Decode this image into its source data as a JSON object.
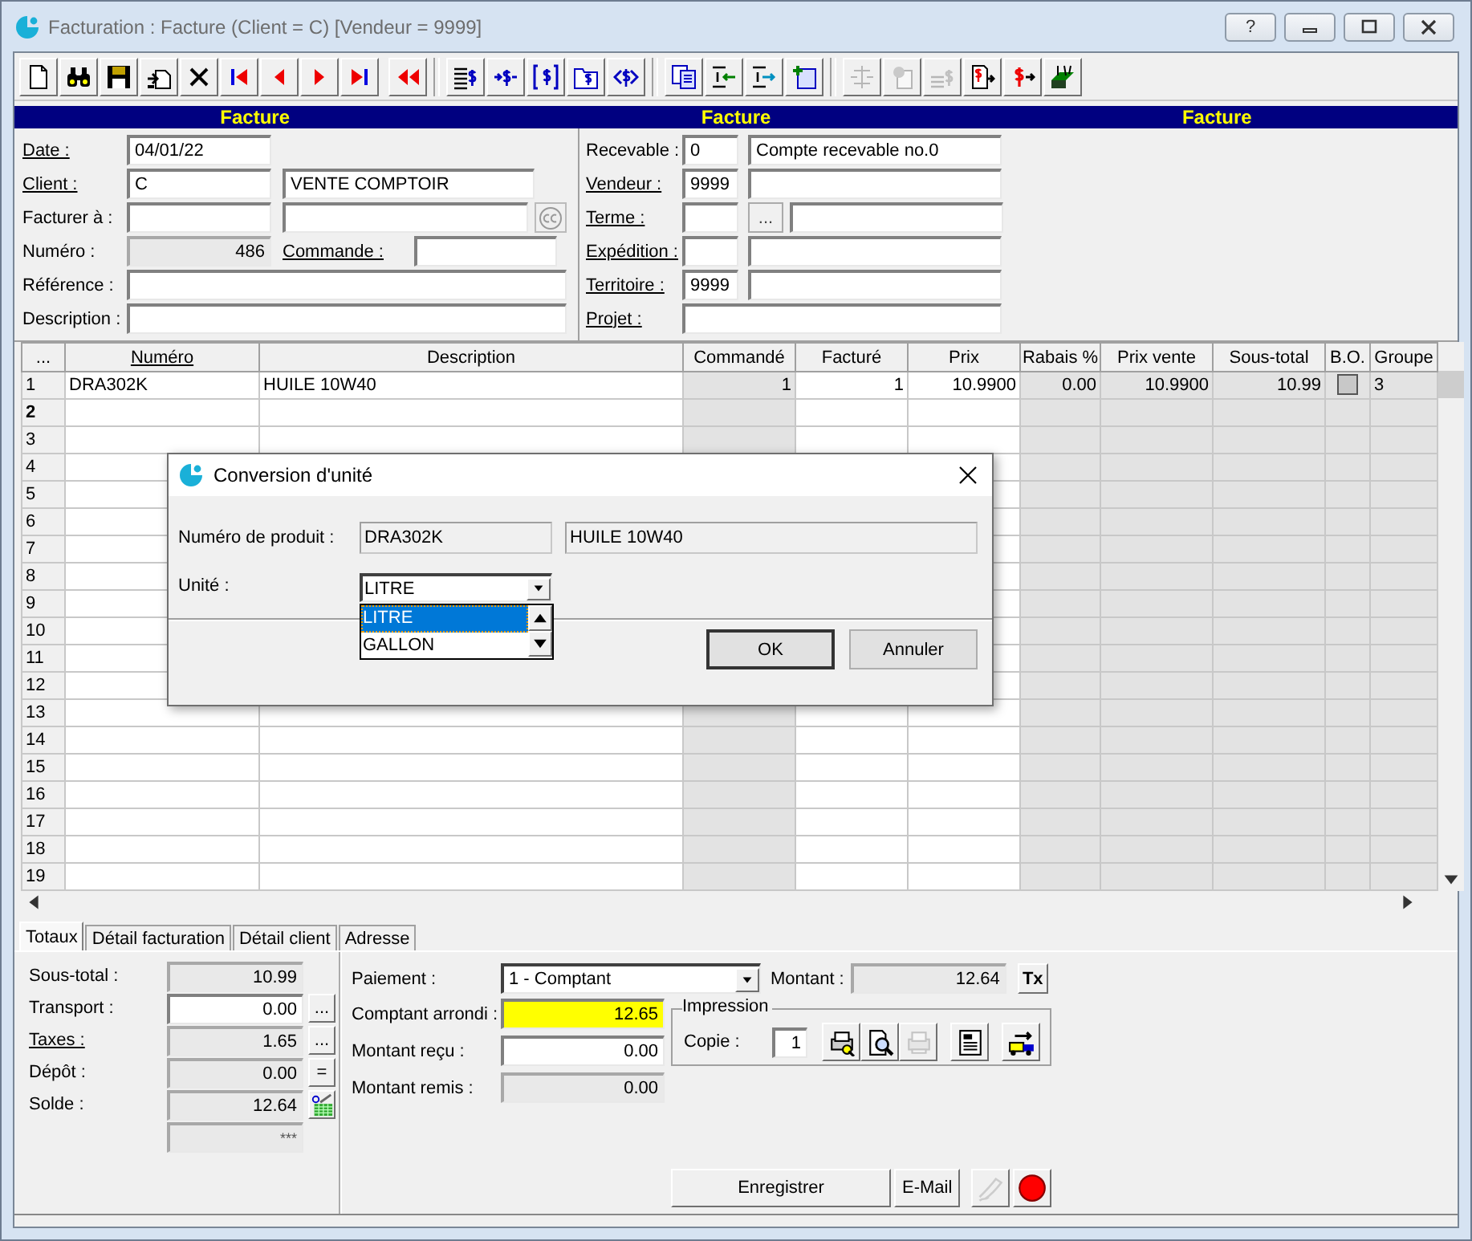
{
  "window": {
    "title": "Facturation : Facture (Client = C) [Vendeur = 9999]",
    "help_button": "?"
  },
  "toolbar": [
    {
      "kind": "document",
      "disabled": false
    },
    {
      "kind": "binoculars",
      "disabled": false
    },
    {
      "kind": "floppy-disk",
      "disabled": false
    },
    {
      "kind": "document-export",
      "disabled": false
    },
    {
      "kind": "delete",
      "disabled": false
    },
    {
      "kind": "skip-back",
      "disabled": false
    },
    {
      "kind": "triangle-left",
      "disabled": false
    },
    {
      "kind": "triangle-right",
      "disabled": false
    },
    {
      "kind": "skip-forward",
      "disabled": false
    },
    {
      "kind": "double-triangle-left",
      "disabled": false
    },
    {
      "kind": "list-dollar",
      "disabled": false
    },
    {
      "kind": "arrows-dollar",
      "disabled": false
    },
    {
      "kind": "bracket-dollar",
      "disabled": false
    },
    {
      "kind": "folder-dollar",
      "disabled": false
    },
    {
      "kind": "dollar-arrows",
      "disabled": false
    },
    {
      "kind": "documents",
      "disabled": false
    },
    {
      "kind": "indent-left",
      "disabled": false
    },
    {
      "kind": "indent-right",
      "disabled": false
    },
    {
      "kind": "add-document",
      "disabled": false
    },
    {
      "kind": "split-arrows",
      "disabled": true
    },
    {
      "kind": "gear-document",
      "disabled": true
    },
    {
      "kind": "lines-dollar",
      "disabled": true
    },
    {
      "kind": "document-arrow",
      "disabled": false
    },
    {
      "kind": "dollar-arrow",
      "disabled": false
    },
    {
      "kind": "tray",
      "disabled": false
    }
  ],
  "header_bar": [
    "Facture",
    "Facture",
    "Facture"
  ],
  "form": {
    "date": {
      "label": "Date :",
      "underlined": true,
      "value": "04/01/22"
    },
    "client": {
      "label": "Client :",
      "underlined": true,
      "code": "C",
      "name": "VENTE COMPTOIR"
    },
    "bill_to": {
      "label": "Facturer à :",
      "underlined": false
    },
    "number": {
      "label": "Numéro :",
      "underlined": false,
      "value": "486"
    },
    "order": {
      "label": "Commande :",
      "underlined": true
    },
    "reference": {
      "label": "Référence :",
      "underlined": false
    },
    "description": {
      "label": "Description :",
      "underlined": false
    },
    "receivable": {
      "label": "Recevable :",
      "underlined": false,
      "code": "0",
      "name": "Compte recevable no.0"
    },
    "seller": {
      "label": "Vendeur :",
      "underlined": true,
      "code": "9999"
    },
    "term": {
      "label": "Terme :",
      "underlined": true,
      "button": "..."
    },
    "shipping": {
      "label": "Expédition :",
      "underlined": true
    },
    "territory": {
      "label": "Territoire :",
      "underlined": true,
      "code": "9999"
    },
    "project": {
      "label": "Projet :",
      "underlined": true
    }
  },
  "grid": {
    "row_header": "...",
    "columns": [
      {
        "label": "Numéro",
        "underlined": true,
        "kind": "text",
        "readonly": false
      },
      {
        "label": "Description",
        "underlined": false,
        "kind": "text",
        "readonly": false
      },
      {
        "label": "Commandé",
        "underlined": false,
        "kind": "number",
        "readonly": true
      },
      {
        "label": "Facturé",
        "underlined": false,
        "kind": "number",
        "readonly": false
      },
      {
        "label": "Prix",
        "underlined": false,
        "kind": "number",
        "readonly": false
      },
      {
        "label": "Rabais %",
        "underlined": false,
        "kind": "number",
        "readonly": true
      },
      {
        "label": "Prix vente",
        "underlined": false,
        "kind": "number",
        "readonly": true
      },
      {
        "label": "Sous-total",
        "underlined": false,
        "kind": "number",
        "readonly": true
      },
      {
        "label": "B.O.",
        "underlined": false,
        "kind": "checkbox",
        "readonly": true
      },
      {
        "label": "Groupe",
        "underlined": false,
        "kind": "text",
        "readonly": true
      }
    ],
    "rows": [
      {
        "number": "1",
        "current": false,
        "cells": [
          "DRA302K",
          "HUILE 10W40",
          "1",
          "1",
          "10.9900",
          "0.00",
          "10.9900",
          "10.99",
          "3"
        ],
        "checked": false
      },
      {
        "number": "2",
        "current": true
      },
      {
        "number": "3",
        "current": false
      },
      {
        "number": "4",
        "current": false
      },
      {
        "number": "5",
        "current": false
      },
      {
        "number": "6",
        "current": false
      },
      {
        "number": "7",
        "current": false
      },
      {
        "number": "8",
        "current": false
      },
      {
        "number": "9",
        "current": false
      },
      {
        "number": "10",
        "current": false
      },
      {
        "number": "11",
        "current": false
      },
      {
        "number": "12",
        "current": false
      },
      {
        "number": "13",
        "current": false
      },
      {
        "number": "14",
        "current": false
      },
      {
        "number": "15",
        "current": false
      },
      {
        "number": "16",
        "current": false
      },
      {
        "number": "17",
        "current": false
      },
      {
        "number": "18",
        "current": false
      },
      {
        "number": "19",
        "current": false
      }
    ]
  },
  "tabs": [
    {
      "label": "Totaux",
      "selected": true
    },
    {
      "label": "Détail facturation",
      "selected": false
    },
    {
      "label": "Détail client",
      "selected": false
    },
    {
      "label": "Adresse",
      "selected": false
    }
  ],
  "totals": [
    {
      "label": "Sous-total :",
      "underlined": false,
      "value": "10.99",
      "editable": false
    },
    {
      "label": "Transport :",
      "underlined": false,
      "value": "0.00",
      "editable": true,
      "button": "..."
    },
    {
      "label": "Taxes :",
      "underlined": true,
      "value": "1.65",
      "editable": false,
      "button": "..."
    },
    {
      "label": "Dépôt :",
      "underlined": false,
      "value": "0.00",
      "editable": false,
      "button": "="
    },
    {
      "label": "Solde :",
      "underlined": false,
      "value": "12.64",
      "editable": false,
      "icon": true
    },
    {
      "value": "***",
      "editable": false
    }
  ],
  "payment": {
    "label": "Paiement :",
    "value": "1 - Comptant",
    "amount_label": "Montant :",
    "amount": "12.64",
    "tx_button": "Tx"
  },
  "cash": [
    {
      "label": "Comptant arrondi :",
      "value": "12.65",
      "editable": true,
      "highlight": true
    },
    {
      "label": "Montant reçu :",
      "value": "0.00",
      "editable": true,
      "highlight": false
    },
    {
      "label": "Montant remis :",
      "value": "0.00",
      "editable": false,
      "highlight": false
    }
  ],
  "print": {
    "title": "Impression",
    "copies_label": "Copie :",
    "copies": "1",
    "buttons": [
      {
        "kind": "printer-key",
        "disabled": false
      },
      {
        "kind": "magnifier-document",
        "disabled": false
      },
      {
        "kind": "printer",
        "disabled": true
      },
      {
        "kind": "text-document",
        "disabled": false
      },
      {
        "kind": "truck-arrow",
        "disabled": false
      }
    ]
  },
  "actions": {
    "save": "Enregistrer",
    "email": "E-Mail",
    "buttons": [
      {
        "kind": "signature",
        "disabled": true
      },
      {
        "kind": "stop",
        "disabled": false
      }
    ]
  },
  "dialog": {
    "title": "Conversion d'unité",
    "product_label": "Numéro de produit :",
    "product_code": "DRA302K",
    "product_name": "HUILE 10W40",
    "unit_label": "Unité :",
    "unit_value": "LITRE",
    "options": [
      {
        "label": "LITRE",
        "selected": true
      },
      {
        "label": "GALLON",
        "selected": false
      }
    ],
    "ok": "OK",
    "cancel": "Annuler"
  }
}
